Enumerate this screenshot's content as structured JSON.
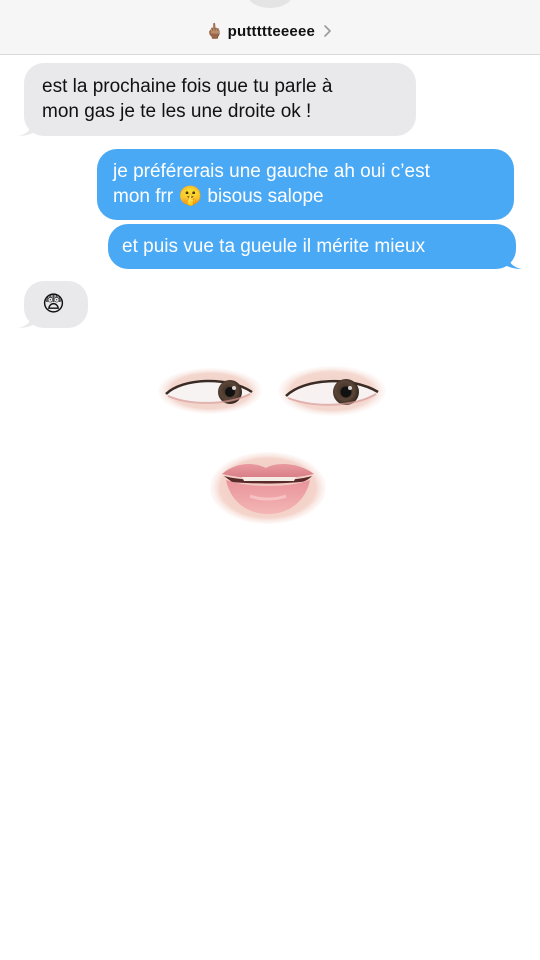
{
  "header": {
    "contact_emoji": "🖕🏽",
    "contact_name": "puttttteeeee"
  },
  "messages": [
    {
      "direction": "incoming",
      "text": "est la prochaine fois que tu parle à\nmon gas je te les une droite ok !"
    },
    {
      "direction": "outgoing",
      "text": "je préférerais une gauche ah oui c’est\nmon frr 🤫 bisous salope"
    },
    {
      "direction": "outgoing",
      "text": "et puis vue ta gueule il mérite mieux"
    },
    {
      "direction": "incoming",
      "text": "😨"
    }
  ],
  "stickers": {
    "eyes": "eye-stickers",
    "mouth": "lips-sticker"
  },
  "colors": {
    "incoming_bubble": "#e9e9eb",
    "outgoing_bubble": "#4aa9f5",
    "header_bg": "#f6f6f6"
  }
}
